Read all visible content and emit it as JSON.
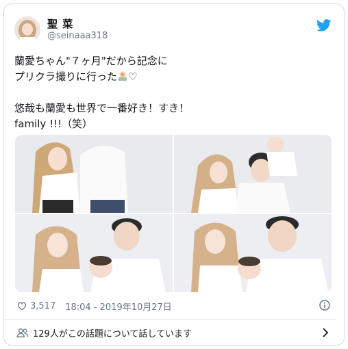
{
  "user": {
    "display_name": "聖 菜",
    "handle": "@seinaaa318"
  },
  "tweet": {
    "line1": "蘭愛ちゃん\"７ヶ月\"だから記念に",
    "line2": "プリクラ撮りに行った",
    "line2_suffix": "♡",
    "line3": "悠哉も蘭愛も世界で一番好き！すき！",
    "line4": "family !!!（笑）"
  },
  "stats": {
    "likes": "3,517",
    "timestamp": "18:04 - 2019年10月27日"
  },
  "footer": {
    "conversation": "129人がこの話題について話しています"
  },
  "icons": {
    "twitter": "twitter-bird-icon",
    "like": "heart-icon",
    "info": "info-icon",
    "people": "people-icon",
    "chevron": "chevron-right-icon",
    "emoji": "sunflower-emoji-icon"
  },
  "colors": {
    "twitter_blue": "#1da1f2",
    "secondary_text": "#657786",
    "border": "#d6dde3"
  }
}
